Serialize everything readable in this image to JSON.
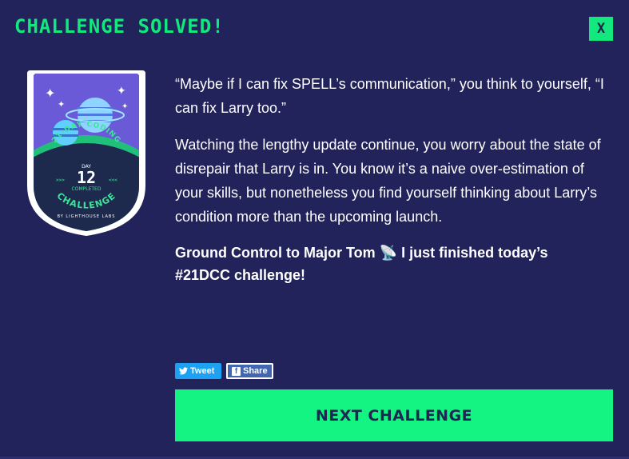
{
  "modal": {
    "title": "CHALLENGE SOLVED!",
    "close_label": "X"
  },
  "badge": {
    "arc_text": "21-DAY CODING",
    "day_label": "DAY",
    "day_number": "12",
    "completed_label": "COMPLETED",
    "challenge_label": "CHALLENGE",
    "byline": "BY LIGHTHOUSE LABS",
    "arrows_left": ">>>",
    "arrows_right": "<<<"
  },
  "content": {
    "paragraph_1": "“Maybe if I can fix SPELL’s communication,” you think to yourself, “I can fix Larry too.”",
    "paragraph_2": "Watching the lengthy update continue, you worry about the state of disrepair that Larry is in. You know it’s a naive over-estimation of your skills, but nonetheless you find yourself thinking about Larry’s condition more than the upcoming launch.",
    "share_message_before": "Ground Control to Major Tom",
    "share_message_emoji": "📡",
    "share_message_after": "I just finished today’s #21DCC challenge!"
  },
  "share": {
    "tweet_label": "Tweet",
    "facebook_label": "Share",
    "facebook_icon_letter": "f"
  },
  "actions": {
    "next_label": "NEXT CHALLENGE"
  },
  "colors": {
    "background": "#22235a",
    "accent_green": "#13e87e",
    "button_green": "#13f483",
    "twitter_blue": "#1da1f2",
    "facebook_blue": "#4267b2"
  },
  "icons": {
    "tweet_icon": "twitter-bird-icon",
    "facebook_icon": "facebook-f-icon",
    "satellite_icon": "satellite-dish-icon"
  }
}
